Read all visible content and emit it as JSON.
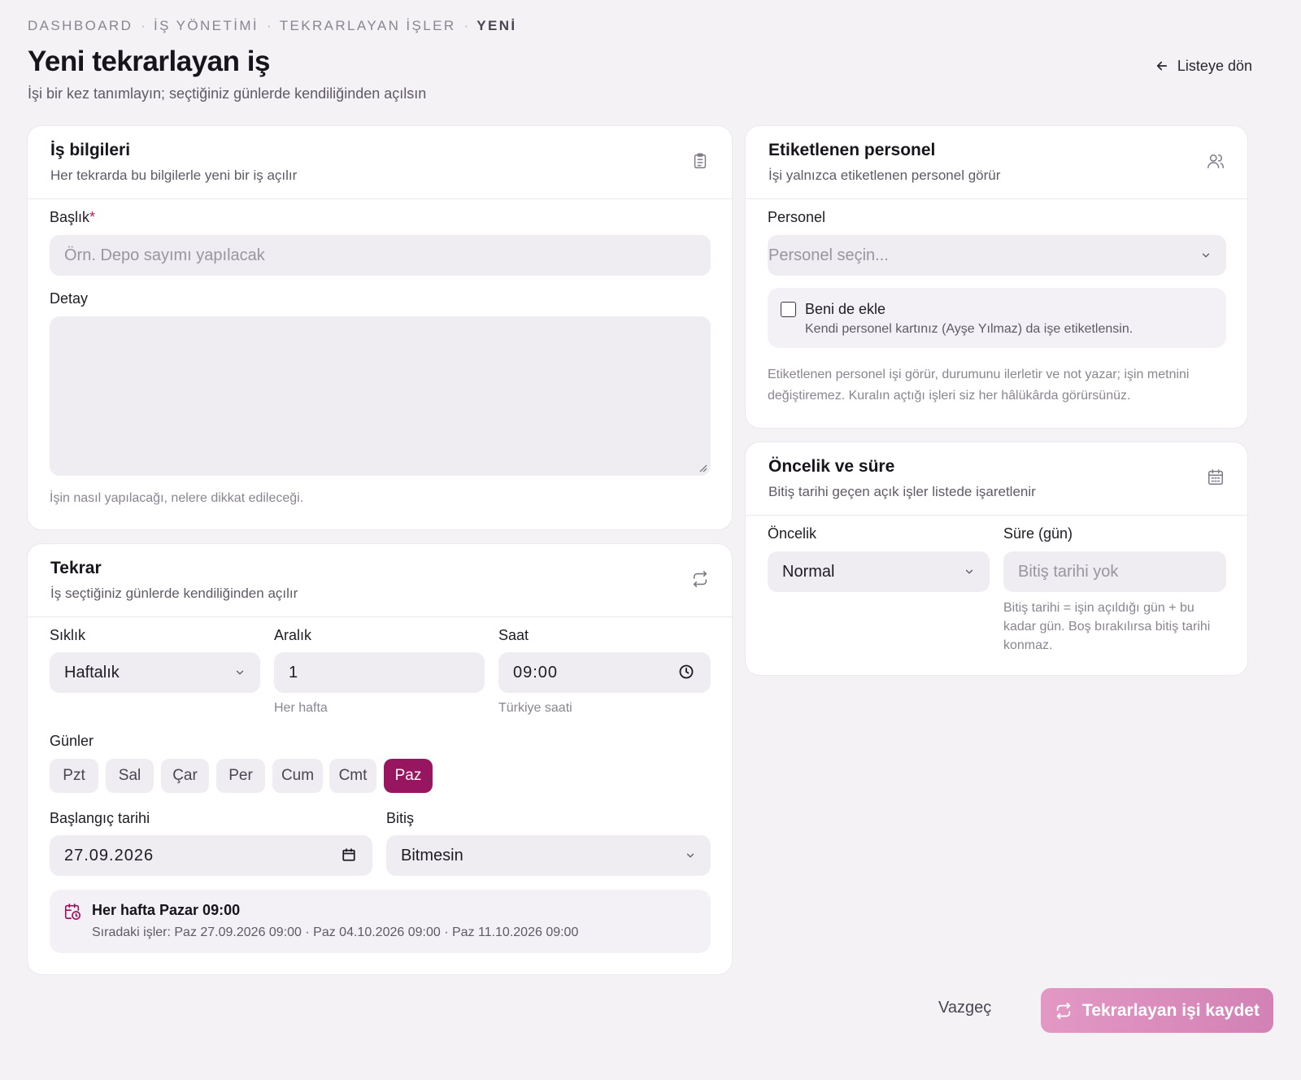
{
  "breadcrumb": [
    "DASHBOARD",
    "İŞ YÖNETİMİ",
    "TEKRARLAYAN İŞLER",
    "YENİ"
  ],
  "page": {
    "title": "Yeni tekrarlayan iş",
    "subtitle": "İşi bir kez tanımlayın; seçtiğiniz günlerde kendiliğinden açılsın",
    "back_label": "Listeye dön"
  },
  "job_info": {
    "title": "İş bilgileri",
    "subtitle": "Her tekrarda bu bilgilerle yeni bir iş açılır",
    "title_label": "Başlık",
    "required_mark": "*",
    "title_placeholder": "Örn. Depo sayımı yapılacak",
    "detail_label": "Detay",
    "detail_hint": "İşin nasıl yapılacağı, nelere dikkat edileceği."
  },
  "repeat": {
    "title": "Tekrar",
    "subtitle": "İş seçtiğiniz günlerde kendiliğinden açılır",
    "frequency_label": "Sıklık",
    "frequency_value": "Haftalık",
    "interval_label": "Aralık",
    "interval_value": "1",
    "interval_hint": "Her hafta",
    "time_label": "Saat",
    "time_value": "09:00",
    "time_hint": "Türkiye saati",
    "days_label": "Günler",
    "days": [
      {
        "label": "Pzt",
        "active": false
      },
      {
        "label": "Sal",
        "active": false
      },
      {
        "label": "Çar",
        "active": false
      },
      {
        "label": "Per",
        "active": false
      },
      {
        "label": "Cum",
        "active": false
      },
      {
        "label": "Cmt",
        "active": false
      },
      {
        "label": "Paz",
        "active": true
      }
    ],
    "start_label": "Başlangıç tarihi",
    "start_value": "27.09.2026",
    "end_label": "Bitiş",
    "end_value": "Bitmesin",
    "summary_title": "Her hafta Pazar 09:00",
    "summary_next": "Sıradaki işler: Paz 27.09.2026 09:00 · Paz 04.10.2026 09:00 · Paz 11.10.2026 09:00"
  },
  "staff": {
    "title": "Etiketlenen personel",
    "subtitle": "İşi yalnızca etiketlenen personel görür",
    "personel_label": "Personel",
    "personel_placeholder": "Personel seçin...",
    "self_title": "Beni de ekle",
    "self_desc": "Kendi personel kartınız (Ayşe Yılmaz) da işe etiketlensin.",
    "self_checked": false,
    "note": "Etiketlenen personel işi görür, durumunu ilerletir ve not yazar; işin metnini değiştiremez. Kuralın açtığı işleri siz her hâlükârda görürsünüz."
  },
  "priority": {
    "title": "Öncelik ve süre",
    "subtitle": "Bitiş tarihi geçen açık işler listede işaretlenir",
    "priority_label": "Öncelik",
    "priority_value": "Normal",
    "duration_label": "Süre (gün)",
    "duration_placeholder": "Bitiş tarihi yok",
    "duration_hint": "Bitiş tarihi = işin açıldığı gün + bu kadar gün. Boş bırakılırsa bitiş tarihi konmaz."
  },
  "actions": {
    "cancel_label": "Vazgeç",
    "save_label": "Tekrarlayan işi kaydet"
  },
  "colors": {
    "accent": "#98155f",
    "save_button": "#db8dbf",
    "background": "#f4f2f5"
  },
  "icons": [
    "clipboard-icon",
    "users-icon",
    "repeat-icon",
    "calendar-icon",
    "clock-icon",
    "arrow-left-icon",
    "chevron-down-icon",
    "calendar-clock-icon"
  ]
}
